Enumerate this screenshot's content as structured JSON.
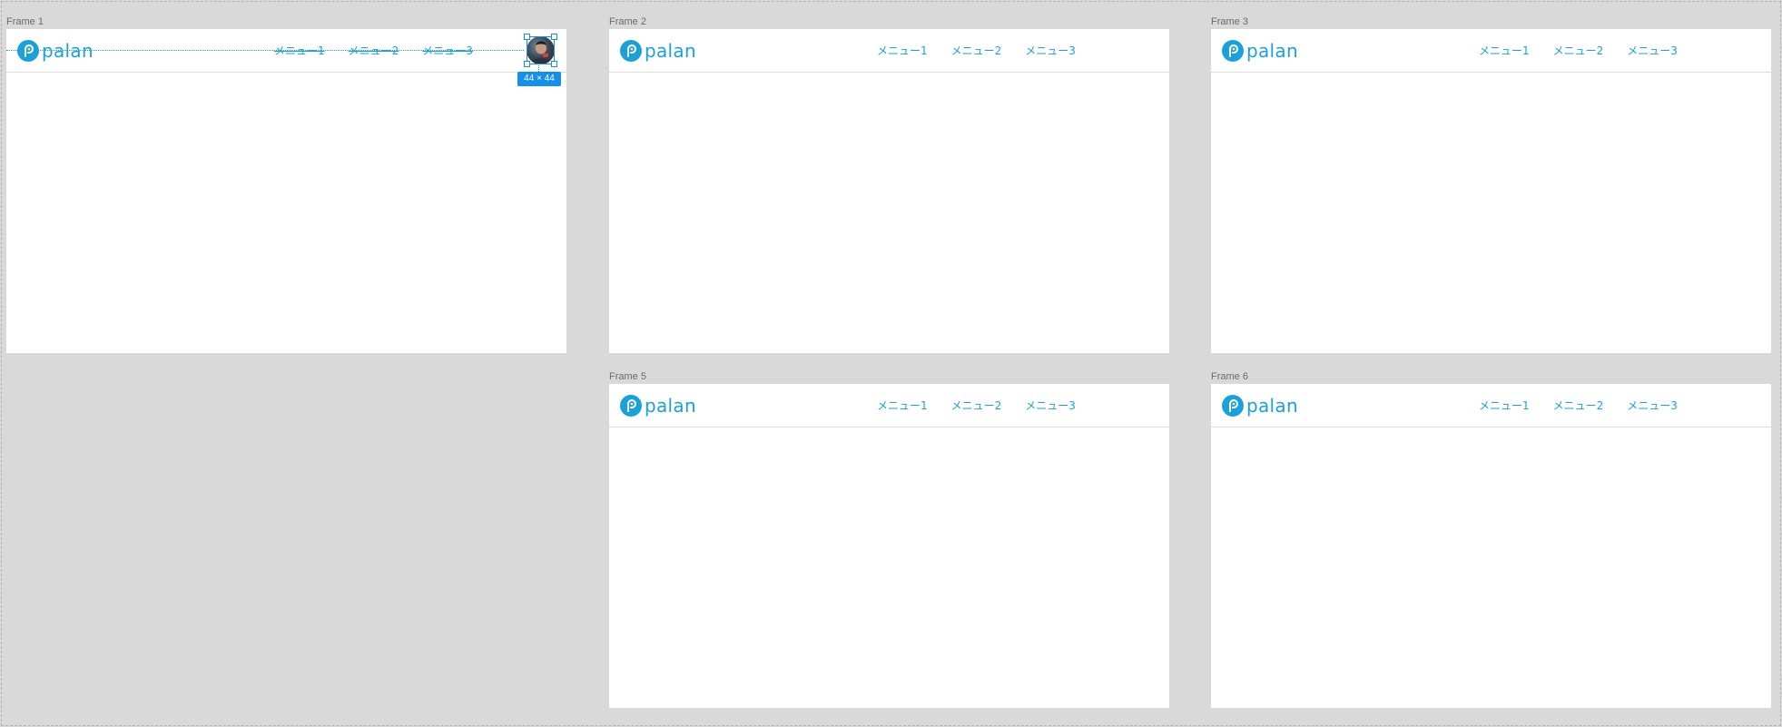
{
  "brand": {
    "name": "palan",
    "color": "#1ba1d8"
  },
  "nav": {
    "items": [
      "メニュー1",
      "メニュー2",
      "メニュー3"
    ]
  },
  "frames": {
    "f1": {
      "label": "Frame 1"
    },
    "f2": {
      "label": "Frame 2"
    },
    "f3": {
      "label": "Frame 3"
    },
    "f5": {
      "label": "Frame 5"
    },
    "f6": {
      "label": "Frame 6"
    }
  },
  "selection": {
    "element": "avatar",
    "size_label": "44 × 44"
  },
  "colors": {
    "canvas": "#d9d9d9",
    "frame": "#ffffff",
    "selection": "#1490e8"
  }
}
